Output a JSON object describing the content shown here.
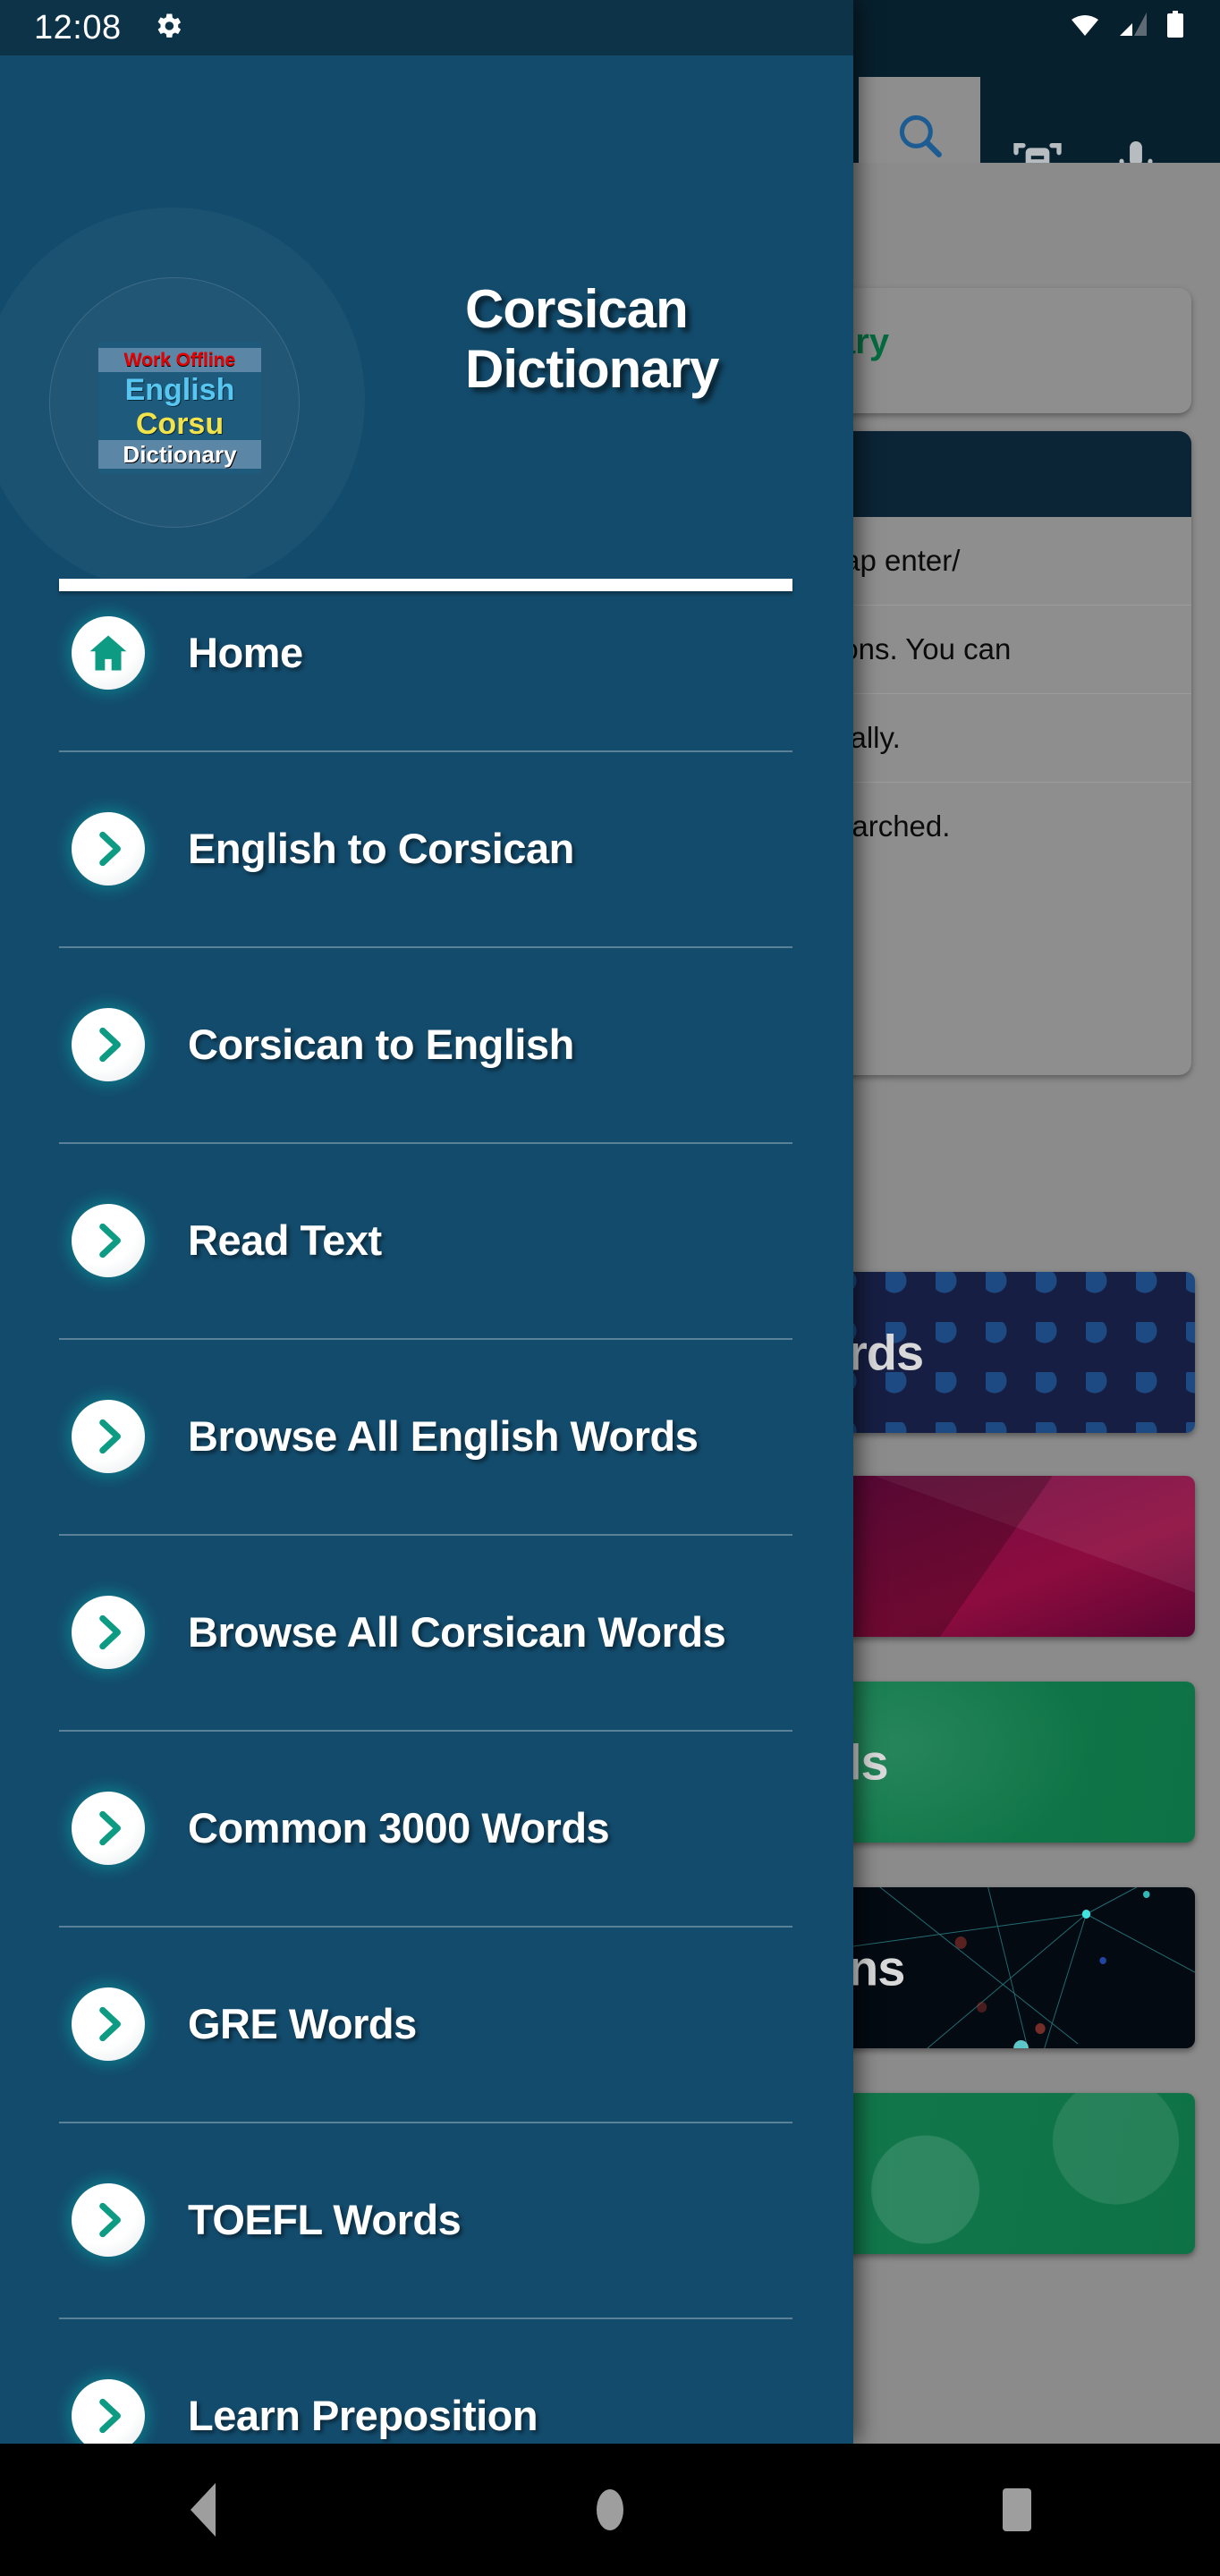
{
  "status_bar": {
    "time": "12:08",
    "settings_icon": "gear-icon",
    "wifi_icon": "wifi-icon",
    "signal_icon": "cell-signal-icon",
    "battery_icon": "battery-full-icon"
  },
  "drawer": {
    "logo": {
      "line1": "Work Offline",
      "line2": "English",
      "line3": "Corsu",
      "line4": "Dictionary"
    },
    "title_line1": "Corsican",
    "title_line2": "Dictionary",
    "items": [
      {
        "label": "Home",
        "icon": "home-icon"
      },
      {
        "label": "English to Corsican",
        "icon": "chevron-right-icon"
      },
      {
        "label": "Corsican to English",
        "icon": "chevron-right-icon"
      },
      {
        "label": "Read Text",
        "icon": "chevron-right-icon"
      },
      {
        "label": "Browse All English Words",
        "icon": "chevron-right-icon"
      },
      {
        "label": "Browse All Corsican Words",
        "icon": "chevron-right-icon"
      },
      {
        "label": "Common 3000 Words",
        "icon": "chevron-right-icon"
      },
      {
        "label": "GRE Words",
        "icon": "chevron-right-icon"
      },
      {
        "label": "TOEFL Words",
        "icon": "chevron-right-icon"
      },
      {
        "label": "Learn Preposition",
        "icon": "chevron-right-icon"
      }
    ]
  },
  "background_app": {
    "toolbar": {
      "search_icon": "search-icon",
      "ocr_icon": "scan-document-icon",
      "mic_icon": "microphone-icon"
    },
    "card_title_fragment": "ary",
    "rows": [
      "tap enter/",
      "ions. You can",
      "cally.",
      "earched."
    ],
    "tiles": [
      {
        "label": "rds",
        "style": "dots"
      },
      {
        "label": "",
        "style": "magenta"
      },
      {
        "label": "ls",
        "style": "green"
      },
      {
        "label": "ns",
        "style": "network"
      },
      {
        "label": "",
        "style": "green2"
      }
    ]
  },
  "nav_bar": {
    "back": "back-icon",
    "home": "home-circle-icon",
    "recents": "recents-icon"
  },
  "colors": {
    "drawer_bg": "#134b6c",
    "status_bg": "#0d3349",
    "accent_teal": "#0d9b84",
    "app_dark": "#07202e",
    "scrim_grey": "#8b8b8b",
    "card_green_text": "#046b3f"
  }
}
